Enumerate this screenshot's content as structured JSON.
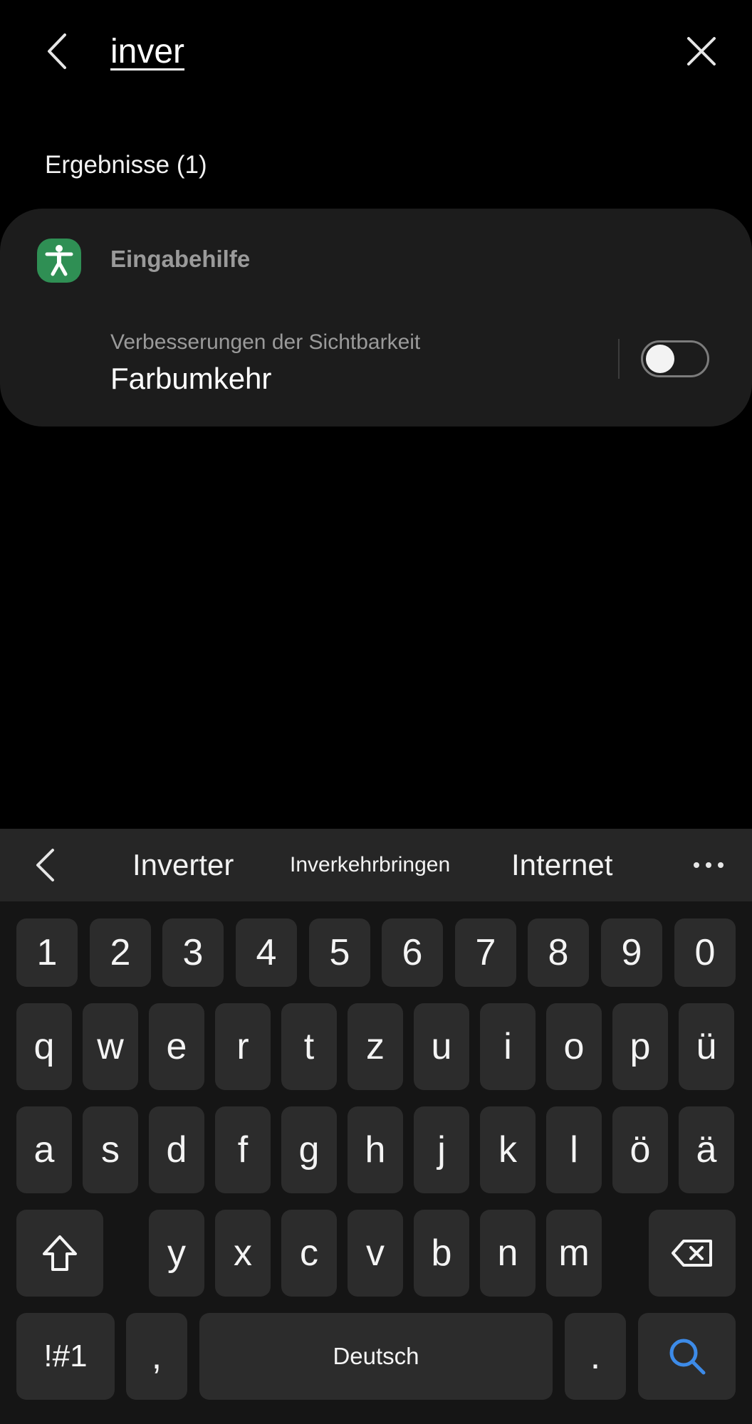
{
  "search": {
    "query": "inver",
    "back_icon": "chevron-left-icon",
    "clear_icon": "close-icon"
  },
  "results": {
    "count_label": "Ergebnisse (1)",
    "items": [
      {
        "category": "Eingabehilfe",
        "category_icon": "accessibility-icon",
        "category_icon_color": "#2f8f54",
        "subtitle": "Verbesserungen der Sichtbarkeit",
        "title": "Farbumkehr",
        "toggle_on": false
      }
    ]
  },
  "keyboard": {
    "suggestions": [
      "Inverter",
      "Inverkehrbringen",
      "Internet"
    ],
    "suggestion_back_icon": "chevron-left-icon",
    "more_icon": "more-horizontal-icon",
    "row_numbers": [
      "1",
      "2",
      "3",
      "4",
      "5",
      "6",
      "7",
      "8",
      "9",
      "0"
    ],
    "row_1": [
      "q",
      "w",
      "e",
      "r",
      "t",
      "z",
      "u",
      "i",
      "o",
      "p",
      "ü"
    ],
    "row_2": [
      "a",
      "s",
      "d",
      "f",
      "g",
      "h",
      "j",
      "k",
      "l",
      "ö",
      "ä"
    ],
    "row_3": [
      "y",
      "x",
      "c",
      "v",
      "b",
      "n",
      "m"
    ],
    "shift_icon": "shift-icon",
    "backspace_icon": "backspace-icon",
    "symbols_label": "!#1",
    "comma_label": ",",
    "space_label": "Deutsch",
    "period_label": ".",
    "search_icon": "search-icon",
    "accent_color": "#3d8be8"
  }
}
